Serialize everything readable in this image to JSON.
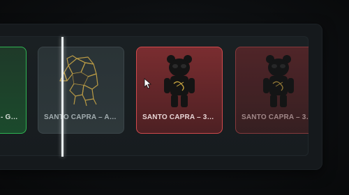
{
  "roll": {
    "items": [
      {
        "label": "SANTO CAPRA - GOL...",
        "rarity": "green",
        "rarity_color": "#2fb653",
        "icon": "capra-figure-icon"
      },
      {
        "label": "SANTO CAPRA – AP...",
        "rarity": "grey",
        "rarity_color": "#3b4549",
        "icon": "capra-geometric-ram-icon"
      },
      {
        "label": "SANTO CAPRA – 3H...",
        "rarity": "red",
        "rarity_color": "#d24a4d",
        "icon": "capra-bear-figure-icon"
      },
      {
        "label": "SANTO CAPRA – 3H...",
        "rarity": "red",
        "rarity_color": "#9a3e41",
        "icon": "capra-bear-figure-icon"
      }
    ]
  }
}
